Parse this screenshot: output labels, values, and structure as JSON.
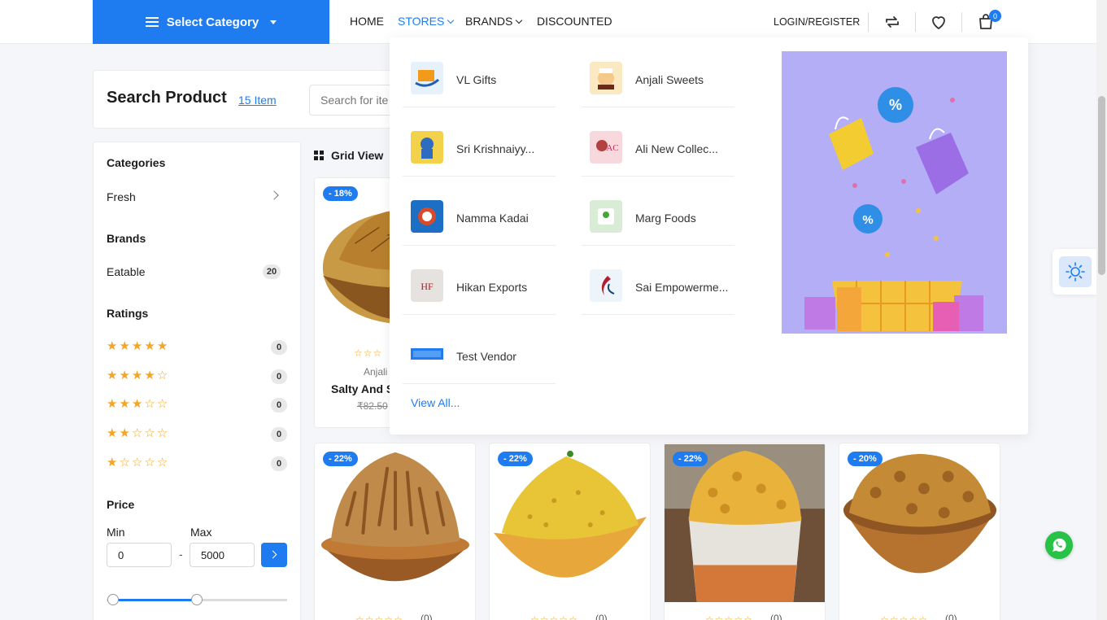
{
  "header": {
    "category_button": "Select Category",
    "nav": [
      {
        "label": "HOME",
        "dropdown": false,
        "active": false
      },
      {
        "label": "STORES",
        "dropdown": true,
        "active": true
      },
      {
        "label": "BRANDS",
        "dropdown": true,
        "active": false
      },
      {
        "label": "DISCOUNTED",
        "dropdown": false,
        "active": false
      }
    ],
    "login": "LOGIN/REGISTER",
    "cart_count": "0",
    "accent": "#1e7cf0"
  },
  "search": {
    "title": "Search Product",
    "count": "15 Item",
    "placeholder": "Search for ite"
  },
  "sidebar": {
    "categories_title": "Categories",
    "categories": [
      {
        "label": "Fresh"
      }
    ],
    "brands_title": "Brands",
    "brands": [
      {
        "label": "Eatable",
        "count": "20"
      }
    ],
    "ratings_title": "Ratings",
    "ratings": [
      {
        "stars": 5,
        "count": "0"
      },
      {
        "stars": 4,
        "count": "0"
      },
      {
        "stars": 3,
        "count": "0"
      },
      {
        "stars": 2,
        "count": "0"
      },
      {
        "stars": 1,
        "count": "0"
      }
    ],
    "price_title": "Price",
    "min_label": "Min",
    "max_label": "Max",
    "min_value": "0",
    "max_value": "5000",
    "dash": "-"
  },
  "view": {
    "label": "Grid View"
  },
  "products": [
    {
      "discount": "- 18%",
      "vendor": "Anjali",
      "name": "Salty And S",
      "old_price": "₹82.50",
      "rating_count": ""
    },
    {
      "discount": "- 22%",
      "rating_count": "(0)"
    },
    {
      "discount": "- 22%",
      "rating_count": "(0)"
    },
    {
      "discount": "- 22%",
      "rating_count": "(0)"
    },
    {
      "discount": "- 20%",
      "rating_count": "(0)"
    }
  ],
  "stores": [
    {
      "name": "VL Gifts"
    },
    {
      "name": "Anjali Sweets"
    },
    {
      "name": "Sri Krishnaiyy..."
    },
    {
      "name": "Ali New Collec..."
    },
    {
      "name": "Namma Kadai"
    },
    {
      "name": "Marg Foods"
    },
    {
      "name": "Hikan Exports"
    },
    {
      "name": "Sai Empowerme..."
    },
    {
      "name": "Test Vendor"
    }
  ],
  "view_all": "View All..."
}
